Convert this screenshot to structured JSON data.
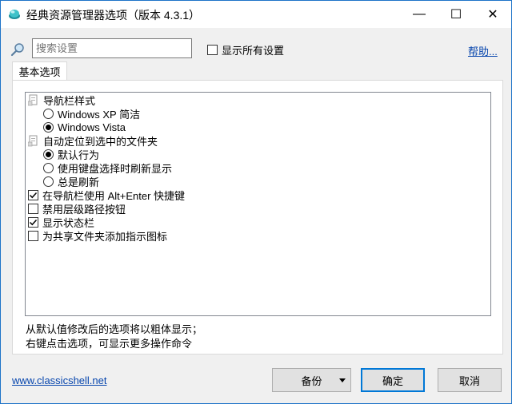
{
  "window": {
    "title": "经典资源管理器选项（版本 4.3.1）",
    "minimize": "—",
    "maximize": "☐",
    "close": "✕"
  },
  "search": {
    "placeholder": "搜索设置"
  },
  "show_all": {
    "label": "显示所有设置",
    "checked": false
  },
  "help": {
    "label": "帮助..."
  },
  "tabs": [
    {
      "label": "基本选项",
      "active": true
    }
  ],
  "settings": [
    {
      "type": "group",
      "label": "导航栏样式"
    },
    {
      "type": "radio",
      "label": "Windows XP 简洁",
      "checked": false
    },
    {
      "type": "radio",
      "label": "Windows Vista",
      "checked": true
    },
    {
      "type": "group",
      "label": "自动定位到选中的文件夹"
    },
    {
      "type": "radio",
      "label": "默认行为",
      "checked": true
    },
    {
      "type": "radio",
      "label": "使用键盘选择时刷新显示",
      "checked": false
    },
    {
      "type": "radio",
      "label": "总是刷新",
      "checked": false
    },
    {
      "type": "checkbox",
      "label": "在导航栏使用 Alt+Enter 快捷键",
      "checked": true
    },
    {
      "type": "checkbox",
      "label": "禁用层级路径按钮",
      "checked": false
    },
    {
      "type": "checkbox",
      "label": "显示状态栏",
      "checked": true
    },
    {
      "type": "checkbox",
      "label": "为共享文件夹添加指示图标",
      "checked": false
    }
  ],
  "hints": {
    "line1": "从默认值修改后的选项将以粗体显示；",
    "line2": "右键点击选项，可显示更多操作命令"
  },
  "footer": {
    "link": "www.classicshell.net",
    "backup_label": "备份",
    "ok_label": "确定",
    "cancel_label": "取消"
  },
  "colors": {
    "window_border": "#1e73c8",
    "link": "#0645ad",
    "default_button_border": "#0078d7"
  },
  "icons": {
    "app": "classic-shell-icon",
    "search": "magnifier-icon",
    "group": "settings-group-icon"
  }
}
